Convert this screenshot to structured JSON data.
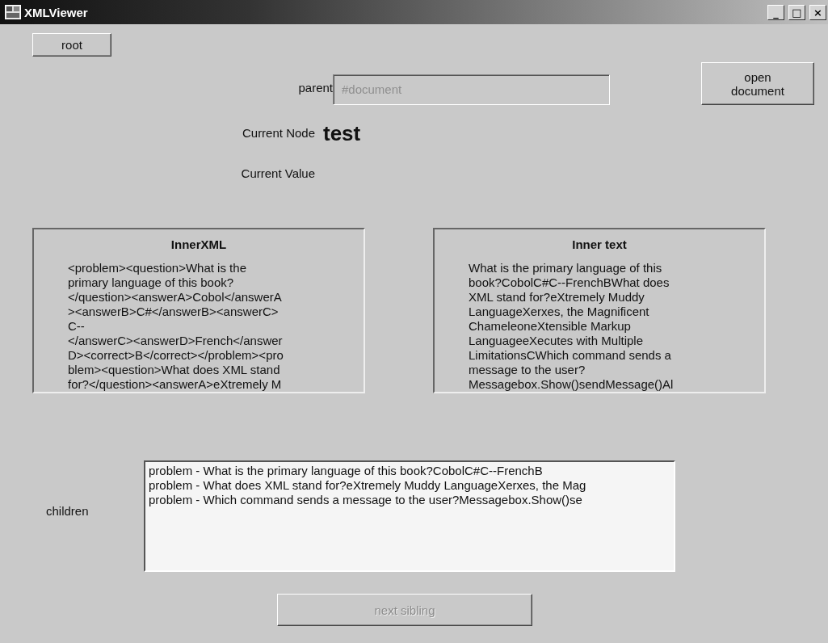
{
  "window": {
    "title": "XMLViewer",
    "controls": [
      "_",
      "□",
      "×"
    ]
  },
  "root_button": {
    "label": "root"
  },
  "parent": {
    "label": "parent",
    "value": "#document",
    "disabled": true
  },
  "open_document_button": {
    "label": "open\ndocument"
  },
  "current_node": {
    "label": "Current Node",
    "value": "test"
  },
  "current_value": {
    "label": "Current Value"
  },
  "panels": [
    {
      "title": "InnerXML",
      "text": "<problem><question>What is the\nprimary language of this book?\n</question><answerA>Cobol</answerA\n><answerB>C#</answerB><answerC>\nC--\n</answerC><answerD>French</answer\nD><correct>B</correct></problem><pro\nblem><question>What does XML stand\nfor?</question><answerA>eXtremely M"
    },
    {
      "title": "Inner text",
      "text": "What is the primary language of this\nbook?CobolC#C--FrenchBWhat does\nXML stand for?eXtremely Muddy\nLanguageXerxes, the Magnificent\nChameleoneXtensible Markup\nLanguageeXecutes with Multiple\nLimitationsCWhich command sends a\nmessage to the user?\nMessagebox.Show()sendMessage()Al"
    }
  ],
  "children": {
    "label": "children",
    "items": [
      "problem - What is the primary language of this book?CobolC#C--FrenchB",
      "problem - What does XML stand for?eXtremely Muddy LanguageXerxes, the Mag",
      "problem - Which command sends a message to the user?Messagebox.Show()se"
    ]
  },
  "next_sibling_button": {
    "label": "next sibling",
    "disabled": true
  }
}
